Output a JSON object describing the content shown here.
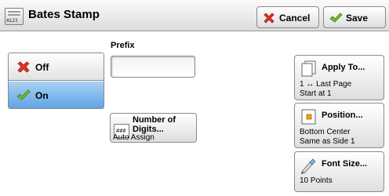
{
  "title_bar": {
    "icon_tag": "A123",
    "title": "Bates Stamp",
    "cancel_label": "Cancel",
    "save_label": "Save"
  },
  "prefix": {
    "label": "Prefix",
    "value": ""
  },
  "mode_toggle": {
    "off_label": "Off",
    "on_label": "On",
    "selected": "On"
  },
  "digits": {
    "icon_text": "###",
    "label_line1": "Number of",
    "label_line2": "Digits...",
    "value": "Auto Assign"
  },
  "apply_to": {
    "label": "Apply To...",
    "value_line1": "1 ↔ Last Page",
    "value_line2": "Start at 1"
  },
  "position": {
    "label": "Position...",
    "value_line1": "Bottom Center",
    "value_line2": "Same as Side 1"
  },
  "font_size": {
    "label": "Font Size...",
    "value": "10 Points"
  },
  "colors": {
    "cancel_icon": "#e0322b",
    "save_icon": "#6fbf2a",
    "selected_toggle": "#5ea3e4",
    "position_icon": "#f0a30a"
  },
  "icons": {
    "title": "bates-stamp-icon",
    "cancel": "x-icon",
    "save": "check-icon",
    "off": "x-icon",
    "on": "check-icon",
    "digits": "number-digits-icon",
    "apply_to": "pages-icon",
    "position": "position-icon",
    "font_size": "font-size-icon"
  }
}
